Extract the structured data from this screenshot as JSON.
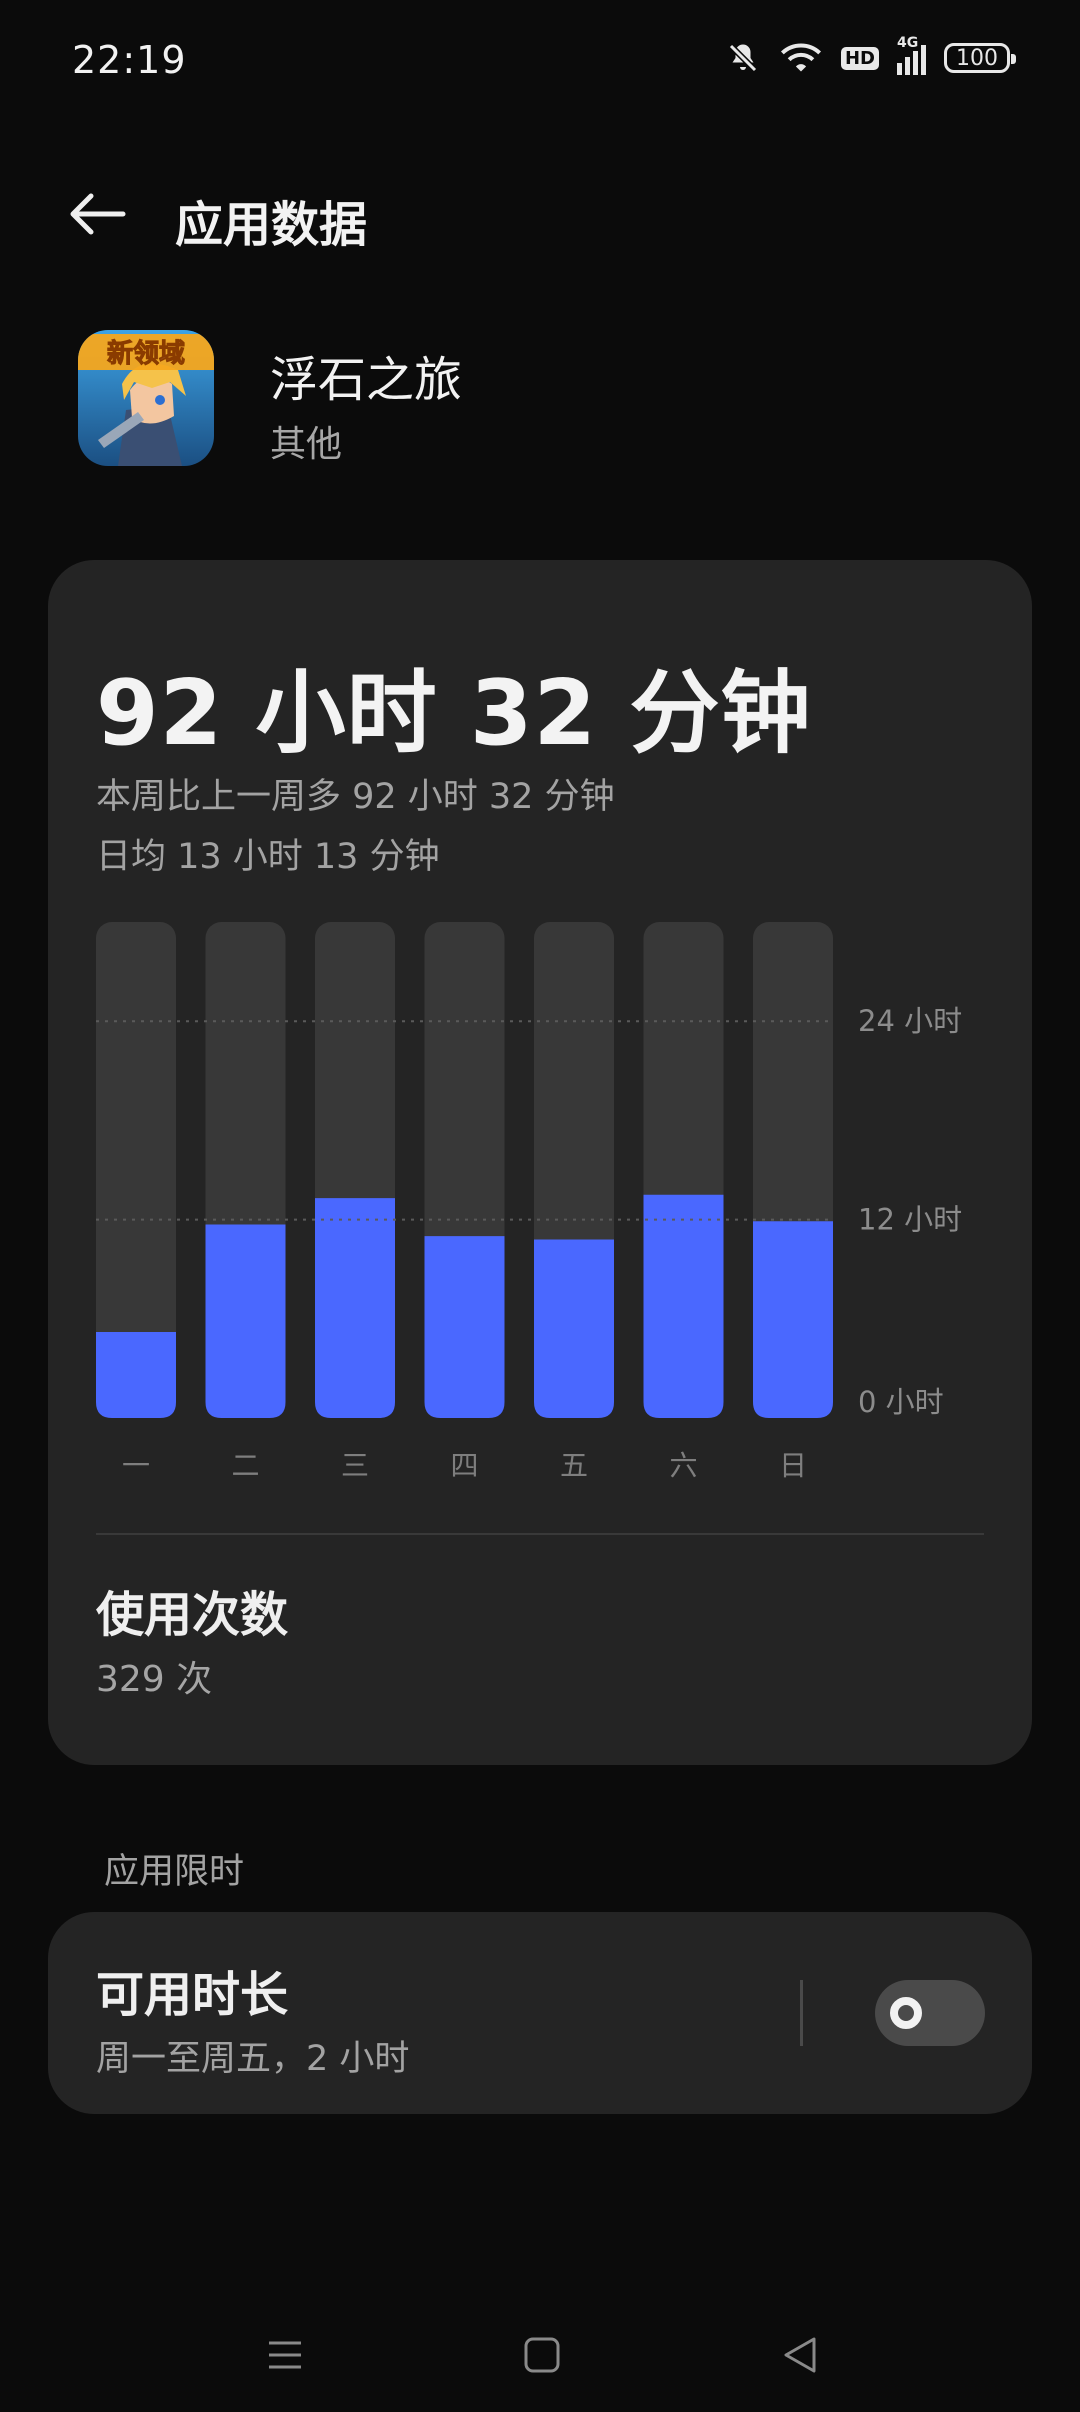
{
  "status_bar": {
    "time": "22:19",
    "battery": "100",
    "network": "4G",
    "hd": "HD"
  },
  "header": {
    "title": "应用数据"
  },
  "app": {
    "name": "浮石之旅",
    "category": "其他",
    "icon_banner": "新领域"
  },
  "usage": {
    "total": "92 小时 32 分钟",
    "compare": "本周比上一周多 92 小时 32 分钟",
    "daily_avg": "日均 13 小时 13 分钟"
  },
  "chart_data": {
    "type": "bar",
    "categories": [
      "一",
      "二",
      "三",
      "四",
      "五",
      "六",
      "日"
    ],
    "values": [
      5.2,
      11.7,
      13.3,
      11.0,
      10.8,
      13.5,
      11.9
    ],
    "y_tick_labels": [
      "0 小时",
      "12 小时",
      "24 小时"
    ],
    "y_ticks": [
      0,
      12,
      24
    ],
    "ylim": [
      0,
      30
    ],
    "bar_color": "#4a68ff",
    "track_color": "#383838"
  },
  "count": {
    "title": "使用次数",
    "value": "329 次"
  },
  "limit": {
    "section": "应用限时",
    "title": "可用时长",
    "subtitle": "周一至周五，2 小时",
    "enabled": false
  }
}
